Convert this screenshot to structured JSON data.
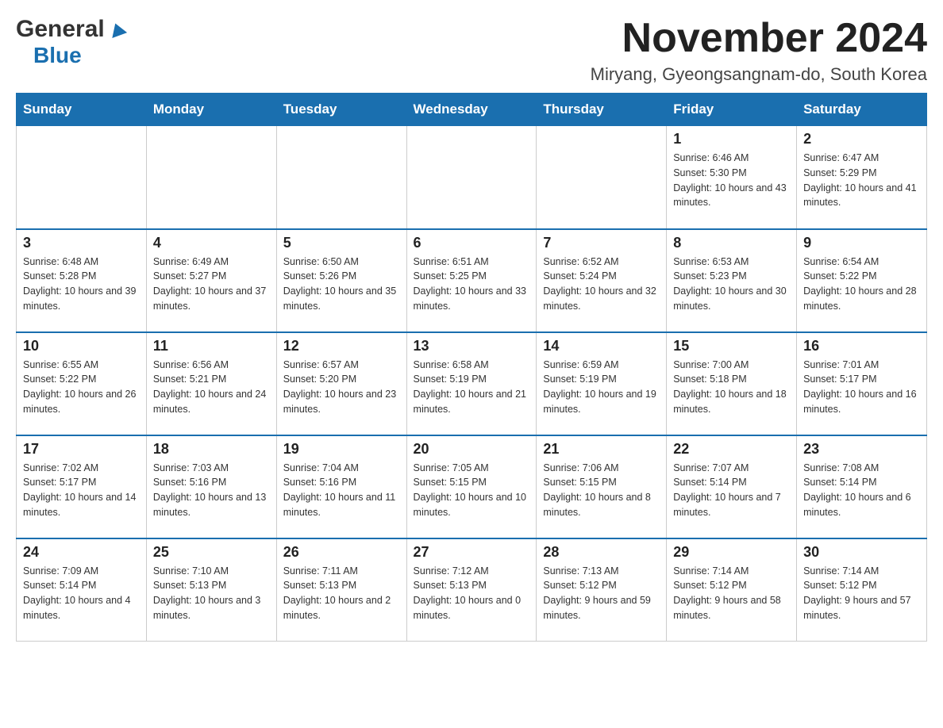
{
  "header": {
    "logo_general": "General",
    "logo_blue": "Blue",
    "month_title": "November 2024",
    "location": "Miryang, Gyeongsangnam-do, South Korea"
  },
  "days_of_week": [
    "Sunday",
    "Monday",
    "Tuesday",
    "Wednesday",
    "Thursday",
    "Friday",
    "Saturday"
  ],
  "weeks": [
    [
      {
        "day": "",
        "info": ""
      },
      {
        "day": "",
        "info": ""
      },
      {
        "day": "",
        "info": ""
      },
      {
        "day": "",
        "info": ""
      },
      {
        "day": "",
        "info": ""
      },
      {
        "day": "1",
        "info": "Sunrise: 6:46 AM\nSunset: 5:30 PM\nDaylight: 10 hours and 43 minutes."
      },
      {
        "day": "2",
        "info": "Sunrise: 6:47 AM\nSunset: 5:29 PM\nDaylight: 10 hours and 41 minutes."
      }
    ],
    [
      {
        "day": "3",
        "info": "Sunrise: 6:48 AM\nSunset: 5:28 PM\nDaylight: 10 hours and 39 minutes."
      },
      {
        "day": "4",
        "info": "Sunrise: 6:49 AM\nSunset: 5:27 PM\nDaylight: 10 hours and 37 minutes."
      },
      {
        "day": "5",
        "info": "Sunrise: 6:50 AM\nSunset: 5:26 PM\nDaylight: 10 hours and 35 minutes."
      },
      {
        "day": "6",
        "info": "Sunrise: 6:51 AM\nSunset: 5:25 PM\nDaylight: 10 hours and 33 minutes."
      },
      {
        "day": "7",
        "info": "Sunrise: 6:52 AM\nSunset: 5:24 PM\nDaylight: 10 hours and 32 minutes."
      },
      {
        "day": "8",
        "info": "Sunrise: 6:53 AM\nSunset: 5:23 PM\nDaylight: 10 hours and 30 minutes."
      },
      {
        "day": "9",
        "info": "Sunrise: 6:54 AM\nSunset: 5:22 PM\nDaylight: 10 hours and 28 minutes."
      }
    ],
    [
      {
        "day": "10",
        "info": "Sunrise: 6:55 AM\nSunset: 5:22 PM\nDaylight: 10 hours and 26 minutes."
      },
      {
        "day": "11",
        "info": "Sunrise: 6:56 AM\nSunset: 5:21 PM\nDaylight: 10 hours and 24 minutes."
      },
      {
        "day": "12",
        "info": "Sunrise: 6:57 AM\nSunset: 5:20 PM\nDaylight: 10 hours and 23 minutes."
      },
      {
        "day": "13",
        "info": "Sunrise: 6:58 AM\nSunset: 5:19 PM\nDaylight: 10 hours and 21 minutes."
      },
      {
        "day": "14",
        "info": "Sunrise: 6:59 AM\nSunset: 5:19 PM\nDaylight: 10 hours and 19 minutes."
      },
      {
        "day": "15",
        "info": "Sunrise: 7:00 AM\nSunset: 5:18 PM\nDaylight: 10 hours and 18 minutes."
      },
      {
        "day": "16",
        "info": "Sunrise: 7:01 AM\nSunset: 5:17 PM\nDaylight: 10 hours and 16 minutes."
      }
    ],
    [
      {
        "day": "17",
        "info": "Sunrise: 7:02 AM\nSunset: 5:17 PM\nDaylight: 10 hours and 14 minutes."
      },
      {
        "day": "18",
        "info": "Sunrise: 7:03 AM\nSunset: 5:16 PM\nDaylight: 10 hours and 13 minutes."
      },
      {
        "day": "19",
        "info": "Sunrise: 7:04 AM\nSunset: 5:16 PM\nDaylight: 10 hours and 11 minutes."
      },
      {
        "day": "20",
        "info": "Sunrise: 7:05 AM\nSunset: 5:15 PM\nDaylight: 10 hours and 10 minutes."
      },
      {
        "day": "21",
        "info": "Sunrise: 7:06 AM\nSunset: 5:15 PM\nDaylight: 10 hours and 8 minutes."
      },
      {
        "day": "22",
        "info": "Sunrise: 7:07 AM\nSunset: 5:14 PM\nDaylight: 10 hours and 7 minutes."
      },
      {
        "day": "23",
        "info": "Sunrise: 7:08 AM\nSunset: 5:14 PM\nDaylight: 10 hours and 6 minutes."
      }
    ],
    [
      {
        "day": "24",
        "info": "Sunrise: 7:09 AM\nSunset: 5:14 PM\nDaylight: 10 hours and 4 minutes."
      },
      {
        "day": "25",
        "info": "Sunrise: 7:10 AM\nSunset: 5:13 PM\nDaylight: 10 hours and 3 minutes."
      },
      {
        "day": "26",
        "info": "Sunrise: 7:11 AM\nSunset: 5:13 PM\nDaylight: 10 hours and 2 minutes."
      },
      {
        "day": "27",
        "info": "Sunrise: 7:12 AM\nSunset: 5:13 PM\nDaylight: 10 hours and 0 minutes."
      },
      {
        "day": "28",
        "info": "Sunrise: 7:13 AM\nSunset: 5:12 PM\nDaylight: 9 hours and 59 minutes."
      },
      {
        "day": "29",
        "info": "Sunrise: 7:14 AM\nSunset: 5:12 PM\nDaylight: 9 hours and 58 minutes."
      },
      {
        "day": "30",
        "info": "Sunrise: 7:14 AM\nSunset: 5:12 PM\nDaylight: 9 hours and 57 minutes."
      }
    ]
  ]
}
